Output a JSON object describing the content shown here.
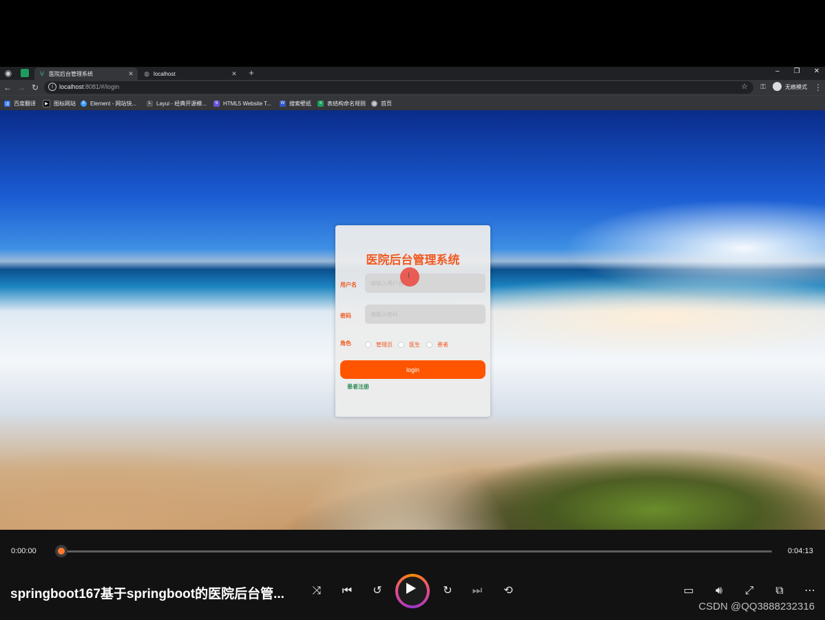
{
  "browser": {
    "tabs": [
      {
        "label": "医院后台管理系统",
        "icon": "vue-icon",
        "active": true
      },
      {
        "label": "localhost",
        "icon": "globe-icon",
        "active": false
      }
    ],
    "address": {
      "host": "localhost",
      "rest": ":8081/#/login"
    },
    "profile_label": "无痕模式",
    "bookmarks": [
      "百度翻译",
      "图标网站",
      "Element - 网站快...",
      "Layui - 经典开源模...",
      "HTML5 Website T...",
      "搜索壁纸",
      "表结构命名规则",
      "首页"
    ]
  },
  "login": {
    "title": "医院后台管理系统",
    "username_label": "用户名",
    "username_placeholder": "请输入用户名",
    "password_label": "密码",
    "password_placeholder": "请输入密码",
    "role_label": "角色",
    "roles": [
      "管理员",
      "医生",
      "患者"
    ],
    "login_button": "login",
    "register_link": "患者注册"
  },
  "player": {
    "current_time": "0:00:00",
    "total_time": "0:04:13",
    "progress": 0.0,
    "video_title": "springboot167基于springboot的医院后台管...",
    "watermark": "CSDN @QQ3888232316"
  },
  "colors": {
    "accent": "#f15a22",
    "login_button": "#ff5500",
    "register_link": "#2e8b57",
    "player_thumb": "#ff7a2f"
  }
}
